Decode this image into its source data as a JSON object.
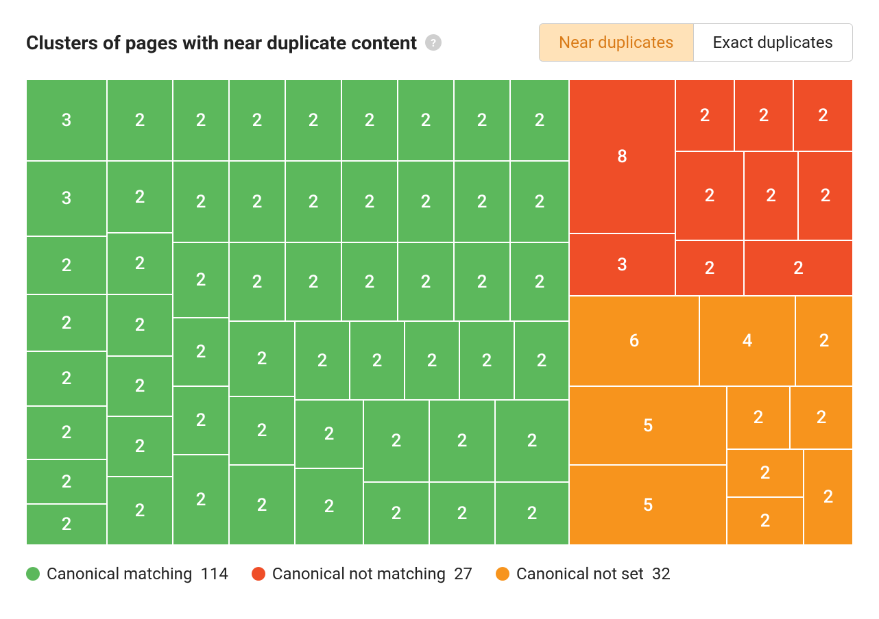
{
  "header": {
    "title": "Clusters of pages with near duplicate content",
    "toggle": {
      "near": "Near duplicates",
      "exact": "Exact duplicates"
    }
  },
  "legend": {
    "matching": {
      "label": "Canonical matching",
      "count": "114",
      "color": "#5cb85c"
    },
    "notmatching": {
      "label": "Canonical not matching",
      "count": "27",
      "color": "#ef4e28"
    },
    "notset": {
      "label": "Canonical not set",
      "count": "32",
      "color": "#f7941d"
    }
  },
  "chart_data": {
    "type": "area",
    "title": "Clusters of pages with near duplicate content",
    "series": [
      {
        "name": "Canonical matching",
        "color": "#5cb85c",
        "total": 114,
        "values": [
          3,
          3,
          2,
          2,
          2,
          2,
          2,
          2,
          2,
          2,
          2,
          2,
          2,
          2,
          2,
          2,
          2,
          2,
          2,
          2,
          2,
          2,
          2,
          2,
          2,
          2,
          2,
          2,
          2,
          2,
          2,
          2,
          2,
          2,
          2,
          2,
          2,
          2,
          2,
          2,
          2,
          2,
          2,
          2,
          2,
          2,
          2,
          2,
          2,
          2,
          2,
          2,
          2,
          2,
          2,
          2
        ]
      },
      {
        "name": "Canonical not matching",
        "color": "#ef4e28",
        "total": 27,
        "values": [
          8,
          3,
          2,
          2,
          2,
          2,
          2,
          2,
          2,
          2
        ]
      },
      {
        "name": "Canonical not set",
        "color": "#f7941d",
        "total": 32,
        "values": [
          6,
          5,
          5,
          4,
          2,
          2,
          2,
          2,
          2,
          2
        ]
      }
    ]
  },
  "cells": {
    "g_r1c1": "3",
    "g_r1c2": "2",
    "g_r1c3": "2",
    "g_r1c4": "2",
    "g_r1c5": "2",
    "g_r1c6": "2",
    "g_r1c7": "2",
    "g_r1c8": "2",
    "g_r1c9": "2",
    "g_r2c1": "3",
    "g_r2a": "2",
    "g_r2b": "2",
    "g_r2c3": "2",
    "g_r2c4": "2",
    "g_r2c5": "2",
    "g_r2c6": "2",
    "g_r2c7": "2",
    "g_r2c8": "2",
    "g_r2c9": "2",
    "g_r3c1": "2",
    "g_r3c3": "2",
    "g_r3c4": "2",
    "g_r3c5": "2",
    "g_r3c6": "2",
    "g_r3c7": "2",
    "g_r3c8": "2",
    "g_r4c1": "2",
    "g_r4b": "2",
    "g_r4c3": "2",
    "g_r4c4": "2",
    "g_r4c5": "2",
    "g_r4c6": "2",
    "g_r4c7": "2",
    "g_r4c8": "2",
    "g_r5c1": "2",
    "g_r5c3": "2",
    "g_r5c4": "2",
    "g_r5c5": "2",
    "g_r5c6": "2",
    "g_r5c7": "2",
    "g_r5c8": "2",
    "g_r6c1": "2",
    "g_r6b": "2",
    "g_r6c3": "2",
    "g_r6c4": "2",
    "g_r6c5": "2",
    "g_r7c1": "2",
    "g_r7c3": "2",
    "g_r7c4": "2",
    "g_r7c5": "2",
    "g_r7c6": "2",
    "g_r7c7": "2",
    "g_r8c1": "2",
    "g_r8b": "2",
    "r_big": "8",
    "r_b2": "3",
    "r_t1": "2",
    "r_t2": "2",
    "r_t3": "2",
    "r_m1": "2",
    "r_m2": "2",
    "r_m3": "2",
    "r_bm": "2",
    "r_br": "2",
    "o_1": "6",
    "o_2": "4",
    "o_3": "2",
    "o_4": "5",
    "o_5": "2",
    "o_6": "2",
    "o_7": "5",
    "o_8": "2",
    "o_9": "2",
    "o_10": "2"
  }
}
